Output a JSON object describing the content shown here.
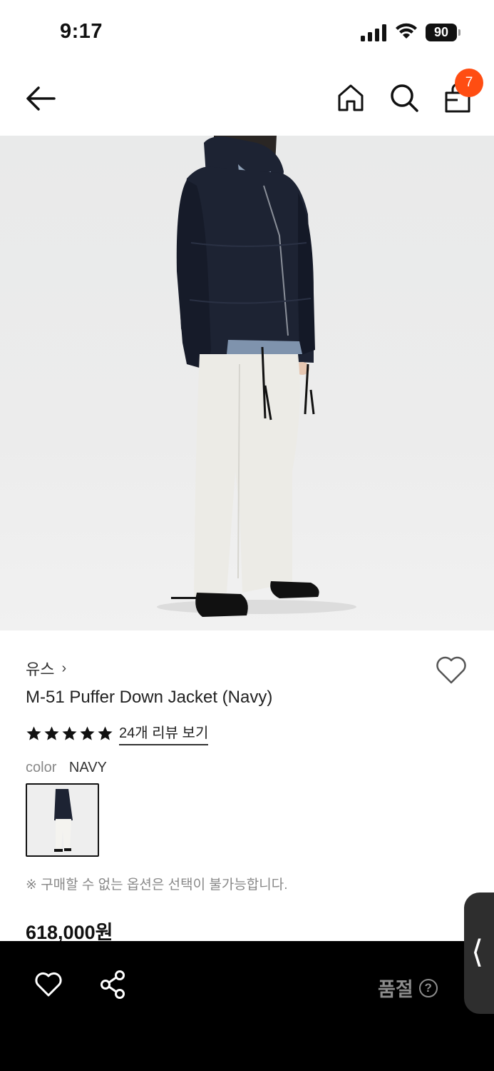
{
  "status_bar": {
    "time": "9:17",
    "battery": "90"
  },
  "nav": {
    "cart_count": "7",
    "icons": [
      "back-arrow-icon",
      "home-icon",
      "search-icon",
      "shopping-bag-icon"
    ]
  },
  "product": {
    "brand": "유스",
    "brand_chevron": "›",
    "title": "M-51 Puffer Down Jacket (Navy)",
    "rating": 5,
    "review_link": "24개 리뷰 보기",
    "color_label": "color",
    "color_value": "NAVY",
    "notice": "※ 구매할 수 없는 옵션은 선택이 불가능합니다.",
    "price": "618,000원"
  },
  "carousel": {
    "current_index": 1
  },
  "bottom_bar": {
    "status_label": "품절",
    "help_glyph": "?"
  },
  "side_handle": {
    "glyph": "⟨"
  },
  "colors": {
    "accent_badge": "#ff4d12",
    "bottom_bar_bg": "#000000",
    "soldout_text": "#8c8c8c",
    "jacket_navy": "#1d2333"
  }
}
